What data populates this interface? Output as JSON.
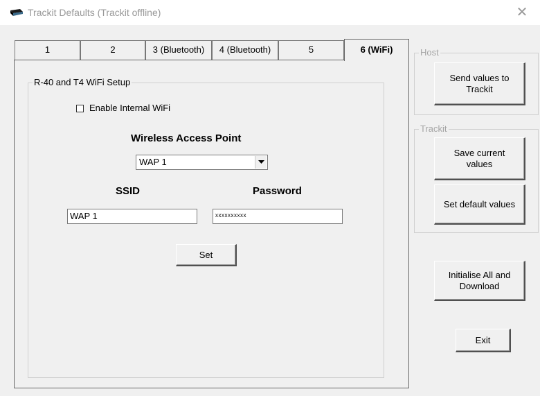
{
  "window": {
    "title": "Trackit Defaults (Trackit offline)",
    "close_glyph": "✕"
  },
  "tabs": [
    {
      "label": "1",
      "active": false
    },
    {
      "label": "2",
      "active": false
    },
    {
      "label": "3 (Bluetooth)",
      "active": false
    },
    {
      "label": "4 (Bluetooth)",
      "active": false
    },
    {
      "label": "5",
      "active": false
    },
    {
      "label": "6 (WiFi)",
      "active": true
    }
  ],
  "wifi": {
    "group_title": "R-40 and T4 WiFi Setup",
    "enable_label": "Enable Internal WiFi",
    "enable_checked": false,
    "wap_heading": "Wireless Access Point",
    "wap_value": "WAP 1",
    "ssid_heading": "SSID",
    "password_heading": "Password",
    "ssid_value": "WAP 1",
    "password_value": "xxxxxxxxxx",
    "set_label": "Set"
  },
  "host": {
    "group_title": "Host",
    "send_label_line1": "Send values to",
    "send_label_line2": "Trackit"
  },
  "trackit": {
    "group_title": "Trackit",
    "save_label_line1": "Save current",
    "save_label_line2": "values",
    "default_label": "Set default values"
  },
  "actions": {
    "init_label_line1": "Initialise All and",
    "init_label_line2": "Download",
    "exit_label": "Exit"
  },
  "icons": {
    "app": "trackit-device-icon",
    "close": "close-icon",
    "dropdown": "chevron-down-icon"
  }
}
